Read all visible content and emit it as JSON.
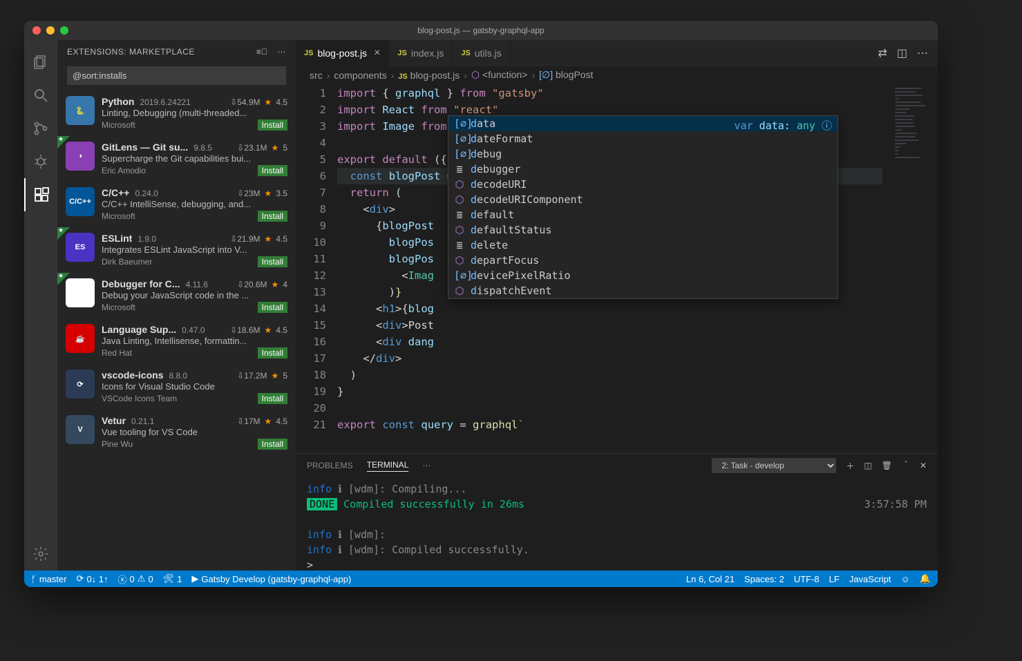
{
  "title": "blog-post.js — gatsby-graphql-app",
  "sidebar": {
    "header": "EXTENSIONS: MARKETPLACE",
    "search_value": "@sort:installs"
  },
  "extensions": [
    {
      "name": "Python",
      "version": "2019.6.24221",
      "downloads": "54.9M",
      "rating": "4.5",
      "desc": "Linting, Debugging (multi-threaded...",
      "publisher": "Microsoft",
      "install": "Install",
      "rec": false,
      "iconBg": "#3776ab",
      "iconText": "🐍"
    },
    {
      "name": "GitLens — Git su...",
      "version": "9.8.5",
      "downloads": "23.1M",
      "rating": "5",
      "desc": "Supercharge the Git capabilities bui...",
      "publisher": "Eric Amodio",
      "install": "Install",
      "rec": true,
      "iconBg": "#8b3fb5",
      "iconText": "◑"
    },
    {
      "name": "C/C++",
      "version": "0.24.0",
      "downloads": "23M",
      "rating": "3.5",
      "desc": "C/C++ IntelliSense, debugging, and...",
      "publisher": "Microsoft",
      "install": "Install",
      "rec": false,
      "iconBg": "#005697",
      "iconText": "C/C++"
    },
    {
      "name": "ESLint",
      "version": "1.9.0",
      "downloads": "21.9M",
      "rating": "4.5",
      "desc": "Integrates ESLint JavaScript into V...",
      "publisher": "Dirk Baeumer",
      "install": "Install",
      "rec": true,
      "iconBg": "#4b32c3",
      "iconText": "ES"
    },
    {
      "name": "Debugger for C...",
      "version": "4.11.6",
      "downloads": "20.6M",
      "rating": "4",
      "desc": "Debug your JavaScript code in the ...",
      "publisher": "Microsoft",
      "install": "Install",
      "rec": true,
      "iconBg": "#fff",
      "iconText": "◉"
    },
    {
      "name": "Language Sup...",
      "version": "0.47.0",
      "downloads": "18.6M",
      "rating": "4.5",
      "desc": "Java Linting, Intellisense, formattin...",
      "publisher": "Red Hat",
      "install": "Install",
      "rec": false,
      "iconBg": "#d60000",
      "iconText": "☕"
    },
    {
      "name": "vscode-icons",
      "version": "8.8.0",
      "downloads": "17.2M",
      "rating": "5",
      "desc": "Icons for Visual Studio Code",
      "publisher": "VSCode Icons Team",
      "install": "Install",
      "rec": false,
      "iconBg": "#2b3a55",
      "iconText": "⟳"
    },
    {
      "name": "Vetur",
      "version": "0.21.1",
      "downloads": "17M",
      "rating": "4.5",
      "desc": "Vue tooling for VS Code",
      "publisher": "Pine Wu",
      "install": "Install",
      "rec": false,
      "iconBg": "#35495e",
      "iconText": "V"
    }
  ],
  "tabs": [
    {
      "label": "blog-post.js",
      "active": true
    },
    {
      "label": "index.js",
      "active": false
    },
    {
      "label": "utils.js",
      "active": false
    }
  ],
  "breadcrumb": [
    "src",
    "components",
    "blog-post.js",
    "<function>",
    "blogPost"
  ],
  "code_lines": [
    {
      "n": 1,
      "html": "<span class='k-pink'>import</span> { <span class='k-var'>graphql</span> } <span class='k-pink'>from</span> <span class='k-str'>\"gatsby\"</span>"
    },
    {
      "n": 2,
      "html": "<span class='k-pink'>import</span> <span class='k-var'>React</span> <span class='k-pink'>from</span> <span class='k-str'>\"react\"</span>"
    },
    {
      "n": 3,
      "html": "<span class='k-pink'>import</span> <span class='k-var'>Image</span> <span class='k-pink'>from</span> <span class='k-link'>\"gatsby-image\"</span>"
    },
    {
      "n": 4,
      "html": ""
    },
    {
      "n": 5,
      "html": "<span class='k-pink'>export</span> <span class='k-pink'>default</span> ({ <span class='k-var'>data</span> }) <span class='k-blue'>=></span> {"
    },
    {
      "n": 6,
      "hl": true,
      "html": "  <span class='k-blue'>const</span> <span class='k-var'>blogPost</span> = <span class='k-var'>d</span><span class='cursor-caret'></span><span class='k-var'>ata</span>.<span class='k-var'>cms</span>.<span class='k-var'>blogPost</span>"
    },
    {
      "n": 7,
      "html": "  <span class='k-pink'>return</span> ("
    },
    {
      "n": 8,
      "html": "    &lt;<span class='k-blue'>div</span>&gt;"
    },
    {
      "n": 9,
      "html": "      {<span class='k-var'>blogPost</span>"
    },
    {
      "n": 10,
      "html": "        <span class='k-var'>blogPos</span>"
    },
    {
      "n": 11,
      "html": "        <span class='k-var'>blogPos</span>"
    },
    {
      "n": 12,
      "html": "          &lt;<span class='k-cyan'>Imag</span>"
    },
    {
      "n": 13,
      "html": "        )<span class='k-fn'>}</span>"
    },
    {
      "n": 14,
      "html": "      &lt;<span class='k-blue'>h1</span>&gt;{<span class='k-var'>blog</span>"
    },
    {
      "n": 15,
      "html": "      &lt;<span class='k-blue'>div</span>&gt;Post"
    },
    {
      "n": 16,
      "html": "      &lt;<span class='k-blue'>div</span> <span class='k-var'>dang</span>"
    },
    {
      "n": 17,
      "html": "    &lt;/<span class='k-blue'>div</span>&gt;"
    },
    {
      "n": 18,
      "html": "  )"
    },
    {
      "n": 19,
      "html": "}"
    },
    {
      "n": 20,
      "html": ""
    },
    {
      "n": 21,
      "html": "<span class='k-pink'>export</span> <span class='k-blue'>const</span> <span class='k-var'>query</span> = <span class='k-fn'>graphql</span><span class='k-str'>`</span>"
    }
  ],
  "suggestions": [
    {
      "icon": "var",
      "label": "data",
      "sel": true,
      "detail": "var data: any"
    },
    {
      "icon": "var",
      "label": "dateFormat"
    },
    {
      "icon": "var",
      "label": "debug"
    },
    {
      "icon": "kw",
      "label": "debugger"
    },
    {
      "icon": "fn",
      "label": "decodeURI"
    },
    {
      "icon": "fn",
      "label": "decodeURIComponent"
    },
    {
      "icon": "kw",
      "label": "default"
    },
    {
      "icon": "fn",
      "label": "defaultStatus"
    },
    {
      "icon": "kw",
      "label": "delete"
    },
    {
      "icon": "fn",
      "label": "departFocus"
    },
    {
      "icon": "var",
      "label": "devicePixelRatio"
    },
    {
      "icon": "fn",
      "label": "dispatchEvent"
    }
  ],
  "panel": {
    "tabs": [
      "PROBLEMS",
      "TERMINAL"
    ],
    "active_tab": "TERMINAL",
    "task_select": "2: Task - develop",
    "terminal_lines": [
      {
        "prefix": "info",
        "body": "[wdm]: Compiling..."
      },
      {
        "done": "DONE",
        "body": "Compiled successfully in 26ms",
        "time": "3:57:58 PM"
      },
      {
        "blank": true
      },
      {
        "prefix": "info",
        "body": "[wdm]:"
      },
      {
        "prefix": "info",
        "body": "[wdm]: Compiled successfully."
      },
      {
        "prompt": ">"
      }
    ]
  },
  "status": {
    "branch": "master",
    "sync": "0↓ 1↑",
    "errors": "0",
    "warnings": "0",
    "tools": "1",
    "running": "Gatsby Develop (gatsby-graphql-app)",
    "pos": "Ln 6, Col 21",
    "spaces": "Spaces: 2",
    "encoding": "UTF-8",
    "eol": "LF",
    "lang": "JavaScript"
  }
}
